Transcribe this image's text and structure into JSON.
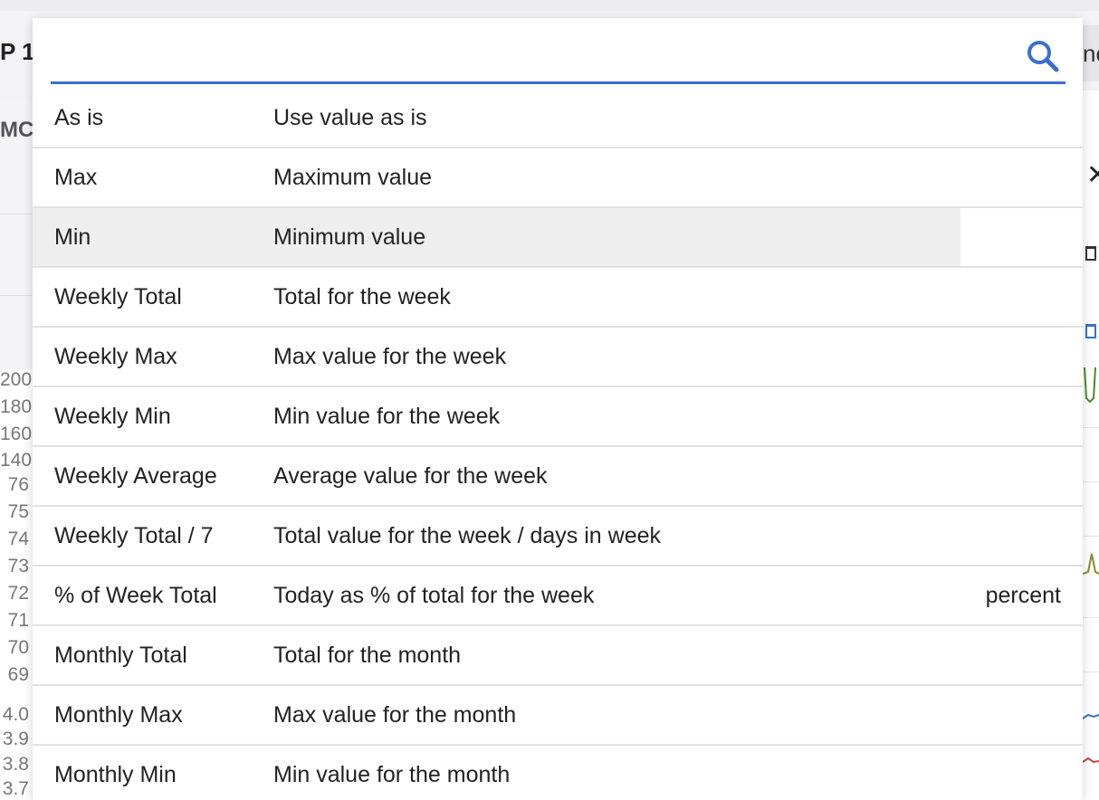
{
  "background": {
    "left_title": "P 1",
    "left_subtitle": "MC",
    "right_top_text": "nc",
    "right_close": "✕",
    "y_ticks": [
      "200",
      "180",
      "160",
      "140",
      "76",
      "75",
      "74",
      "73",
      "72",
      "71",
      "70",
      "69",
      "4.0",
      "3.9",
      "3.8",
      "3.7"
    ]
  },
  "search": {
    "value": "",
    "placeholder": "",
    "icon": "search-icon",
    "accent_color": "#3a6fd0"
  },
  "options": [
    {
      "name": "As is",
      "description": "Use value as is",
      "unit": ""
    },
    {
      "name": "Max",
      "description": "Maximum value",
      "unit": ""
    },
    {
      "name": "Min",
      "description": "Minimum value",
      "unit": "",
      "highlighted": true
    },
    {
      "name": "Weekly Total",
      "description": "Total for the week",
      "unit": ""
    },
    {
      "name": "Weekly Max",
      "description": "Max value for the week",
      "unit": ""
    },
    {
      "name": "Weekly Min",
      "description": "Min value for the week",
      "unit": ""
    },
    {
      "name": "Weekly Average",
      "description": "Average value for the week",
      "unit": ""
    },
    {
      "name": "Weekly Total / 7",
      "description": "Total value for the week / days in week",
      "unit": ""
    },
    {
      "name": "% of Week Total",
      "description": "Today as % of total for the week",
      "unit": "percent"
    },
    {
      "name": "Monthly Total",
      "description": "Total for the month",
      "unit": ""
    },
    {
      "name": "Monthly Max",
      "description": "Max value for the month",
      "unit": ""
    },
    {
      "name": "Monthly Min",
      "description": "Min value for the month",
      "unit": ""
    }
  ]
}
